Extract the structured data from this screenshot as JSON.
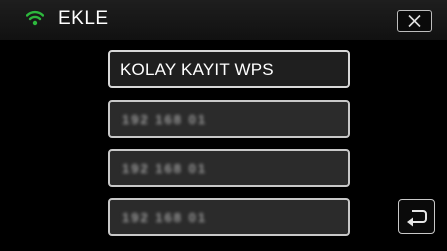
{
  "header": {
    "title": "EKLE",
    "wifi_icon": "wifi-icon",
    "close_icon": "close-icon",
    "accent_color": "#2db83d"
  },
  "list": {
    "items": [
      {
        "label": "KOLAY KAYIT WPS",
        "obscured": false
      },
      {
        "label": "192 168 01",
        "obscured": true
      },
      {
        "label": "192 168 01",
        "obscured": true
      },
      {
        "label": "192 168 01",
        "obscured": true
      }
    ]
  },
  "footer": {
    "back_icon": "return-arrow-icon"
  }
}
